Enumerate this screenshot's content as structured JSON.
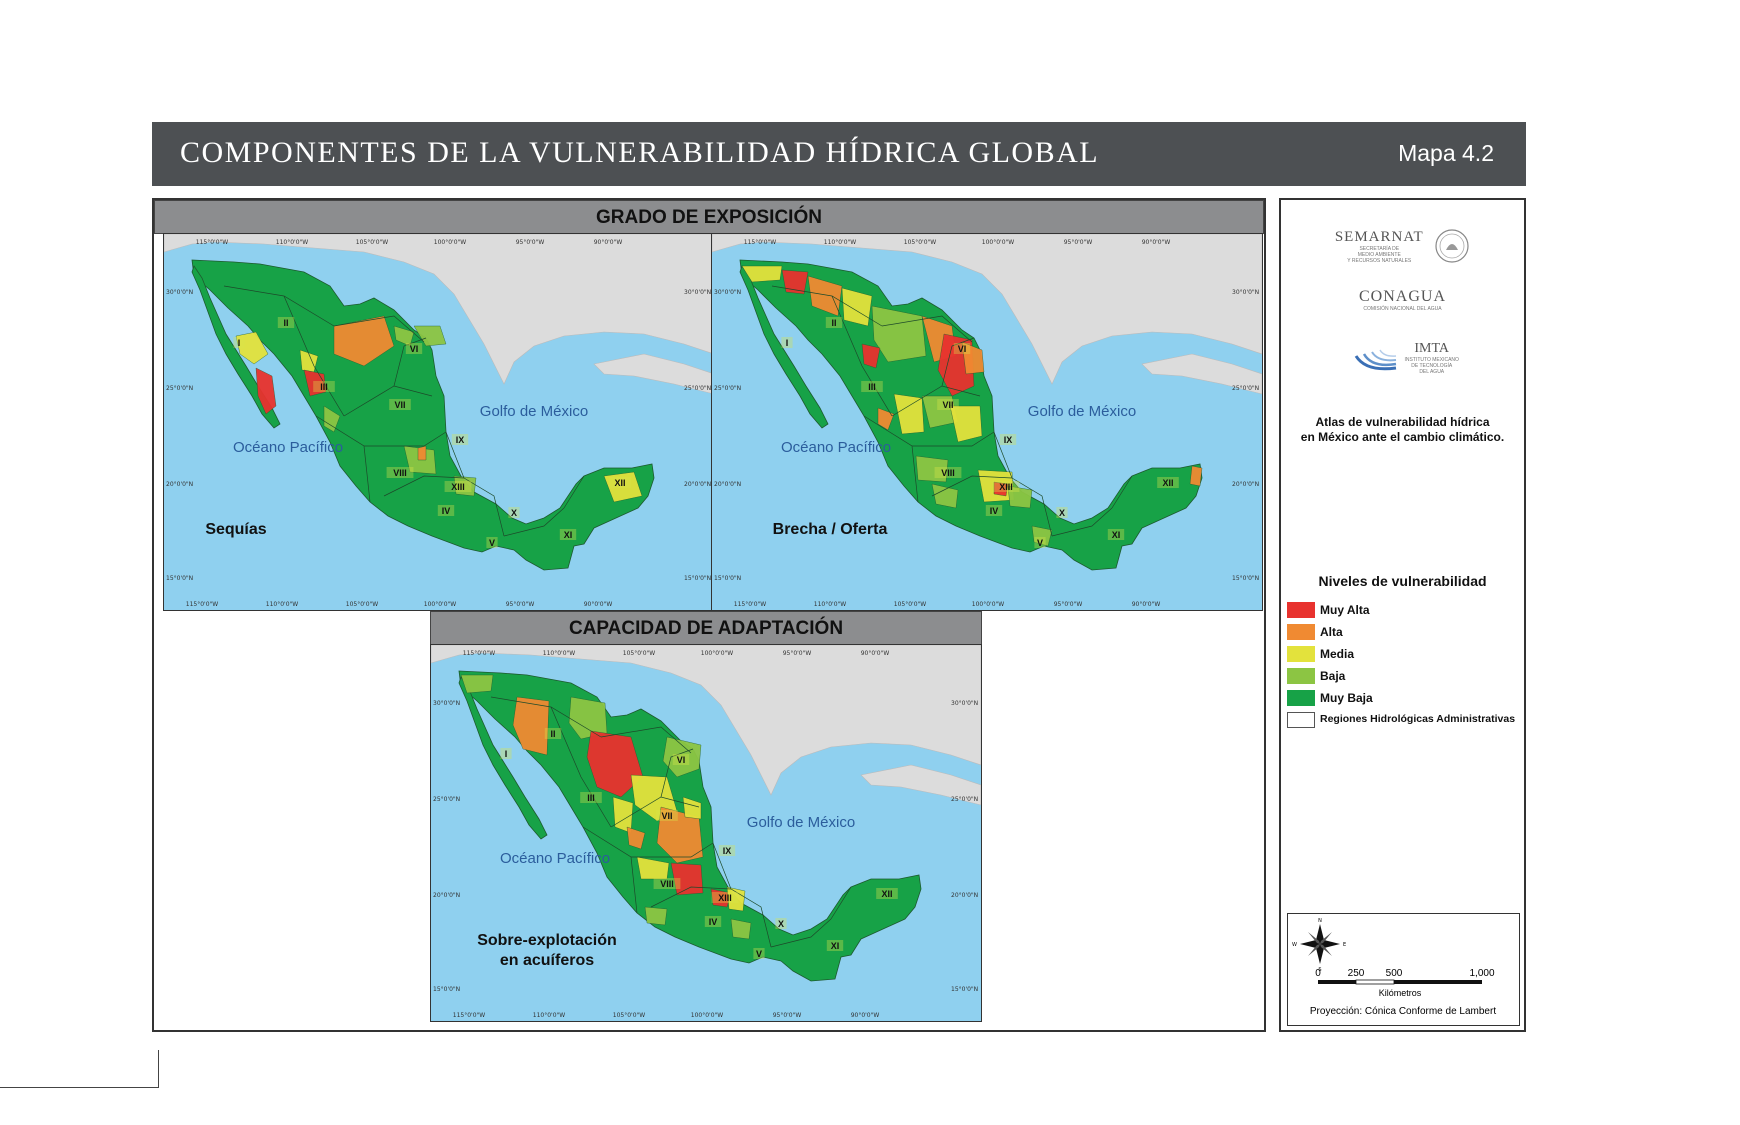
{
  "title": "COMPONENTES DE LA VULNERABILIDAD HÍDRICA GLOBAL",
  "map_number": "Mapa 4.2",
  "sections": {
    "exposure_header": "GRADO DE EXPOSICIÓN",
    "adaptation_header": "CAPACIDAD DE ADAPTACIÓN"
  },
  "maps": [
    {
      "id": "sequias",
      "caption": [
        "Sequías"
      ],
      "gulf": "Golfo de México",
      "ocean": "Océano Pacífico"
    },
    {
      "id": "brecha",
      "caption": [
        "Brecha / Oferta"
      ],
      "gulf": "Golfo de México",
      "ocean": "Océano Pacífico"
    },
    {
      "id": "sobreexplotacion",
      "caption": [
        "Sobre-explotación",
        "en acuíferos"
      ],
      "gulf": "Golfo de México",
      "ocean": "Océano Pacífico"
    }
  ],
  "regions": [
    "I",
    "II",
    "III",
    "IV",
    "V",
    "VI",
    "VII",
    "VIII",
    "IX",
    "X",
    "XI",
    "XII",
    "XIII"
  ],
  "coordinates": {
    "top": [
      "115°0'0\"W",
      "110°0'0\"W",
      "105°0'0\"W",
      "100°0'0\"W",
      "95°0'0\"W",
      "90°0'0\"W"
    ],
    "bottom": [
      "115°0'0\"W",
      "110°0'0\"W",
      "105°0'0\"W",
      "100°0'0\"W",
      "95°0'0\"W",
      "90°0'0\"W"
    ],
    "left": [
      "30°0'0\"N",
      "25°0'0\"N",
      "20°0'0\"N",
      "15°0'0\"N"
    ]
  },
  "sidebar": {
    "semarnat": "SEMARNAT",
    "semarnat_sub": [
      "SECRETARÍA DE",
      "MEDIO AMBIENTE",
      "Y RECURSOS NATURALES"
    ],
    "conagua": "CONAGUA",
    "conagua_sub": "COMISIÓN NACIONAL DEL AGUA",
    "imta": "IMTA",
    "imta_sub": [
      "INSTITUTO MEXICANO",
      "DE TECNOLOGÍA",
      "DEL AGUA"
    ],
    "atlas_line1": "Atlas de vulnerabilidad  hídrica",
    "atlas_line2": "en México ante el cambio climático."
  },
  "legend": {
    "title": "Niveles de vulnerabilidad",
    "items": [
      {
        "label": "Muy Alta",
        "color": "#e8322e"
      },
      {
        "label": "Alta",
        "color": "#f08a32"
      },
      {
        "label": "Media",
        "color": "#e3e23c"
      },
      {
        "label": "Baja",
        "color": "#8cc543"
      },
      {
        "label": "Muy Baja",
        "color": "#17a247"
      },
      {
        "label": "Regiones Hidrológicas Administrativas",
        "color": "#ffffff"
      }
    ]
  },
  "scale": {
    "ticks": [
      "0",
      "250",
      "500",
      "1,000"
    ],
    "unit": "Kilómetros",
    "projection": "Proyección: Cónica Conforme de Lambert",
    "compass": [
      "N",
      "S",
      "E",
      "W"
    ]
  },
  "colors": {
    "title_bar": "#4d5053",
    "ocean": "#8fd0ef",
    "land_other": "#dcdcdc",
    "muy_alta": "#e8322e",
    "alta": "#f08a32",
    "media": "#e3e23c",
    "baja": "#8cc543",
    "muy_baja": "#17a247"
  }
}
